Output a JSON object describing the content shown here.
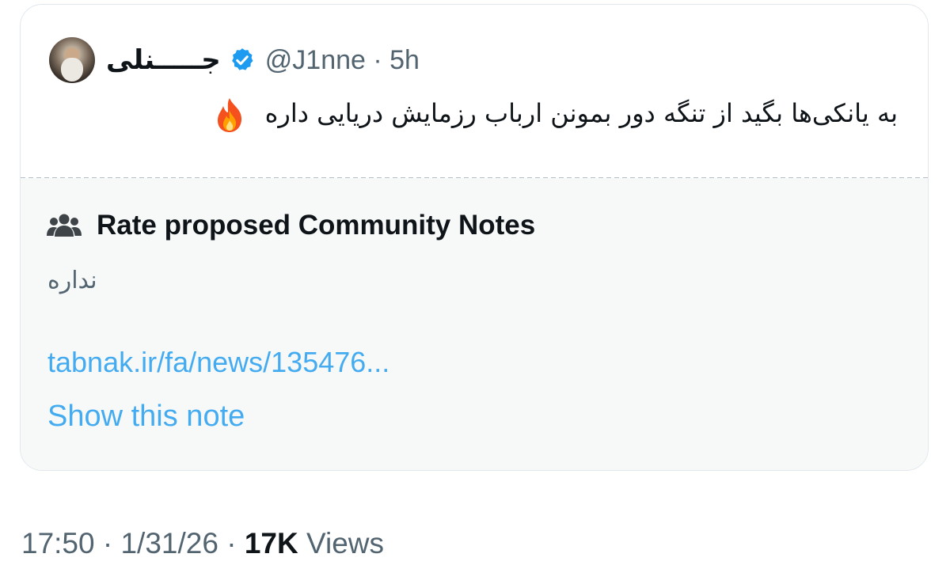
{
  "tweet": {
    "author_name": "جـــــنلی",
    "handle": "@J1nne",
    "time_ago": "5h",
    "text": "به یانکی‌ها بگید از تنگه دور بمونن ارباب رزمایش دریایی داره",
    "verified": true,
    "verified_color": "#1d9bf0"
  },
  "community_notes": {
    "title": "Rate proposed Community Notes",
    "note_text": "نداره",
    "link": "tabnak.ir/fa/news/135476...",
    "show_note_label": "Show this note"
  },
  "meta": {
    "time": "17:50",
    "date": "1/31/26",
    "views_count": "17K",
    "views_label": "Views"
  },
  "icons": [
    "verified-badge-icon",
    "people-icon",
    "fire-emoji-icon"
  ]
}
